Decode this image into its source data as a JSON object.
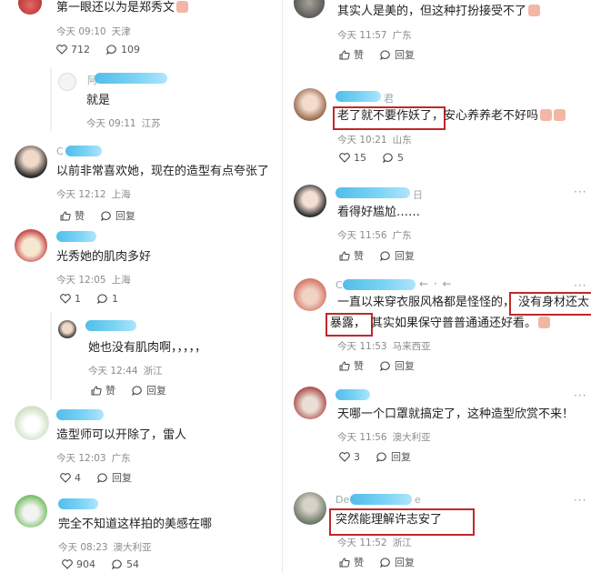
{
  "left": {
    "comments": [
      {
        "text": "第一眼还以为是郑秀文",
        "time": "今天 09:10",
        "loc": "天津",
        "likes": "712",
        "replies": "109"
      },
      {
        "prefix": "阿",
        "text": "就是",
        "time": "今天 09:11",
        "loc": "江苏"
      },
      {
        "prefix": "C",
        "text": "以前非常喜欢她，现在的造型有点夸张了",
        "time": "今天 12:12",
        "loc": "上海",
        "like_label": "赞",
        "reply_label": "回复"
      },
      {
        "text": "光秀她的肌肉多好",
        "time": "今天 12:05",
        "loc": "上海",
        "likes": "1",
        "replies": "1"
      },
      {
        "text": "她也没有肌肉啊，，，，，",
        "time": "今天 12:44",
        "loc": "浙江",
        "like_label": "赞",
        "reply_label": "回复"
      },
      {
        "text": "造型师可以开除了，雷人",
        "time": "今天 12:03",
        "loc": "广东",
        "likes": "4",
        "reply_label": "回复"
      },
      {
        "text": "完全不知道这样拍的美感在哪",
        "time": "今天 08:23",
        "loc": "澳大利亚",
        "likes": "904",
        "replies": "54"
      }
    ]
  },
  "right": {
    "comments": [
      {
        "text": "其实人是美的，但这种打扮接受不了",
        "time": "今天 11:57",
        "loc": "广东",
        "like_label": "赞",
        "reply_label": "回复"
      },
      {
        "suffix": "君",
        "text_boxed": "老了就不要作妖了，",
        "text_rest": "安心养养老不好吗",
        "time": "今天 10:21",
        "loc": "山东",
        "likes": "15",
        "replies": "5"
      },
      {
        "suffix": "日",
        "text": "看得好尴尬……",
        "time": "今天 11:56",
        "loc": "广东",
        "like_label": "赞",
        "reply_label": "回复"
      },
      {
        "prefix": "C",
        "text_line1_a": "一直以来穿衣服风格都是怪怪的，",
        "text_line1_boxed": "没有身材还太",
        "text_line2_boxed": "暴露，",
        "text_line2_rest": "其实如果保守普普通通还好看。",
        "time": "今天 11:53",
        "loc": "马来西亚",
        "like_label": "赞",
        "reply_label": "回复"
      },
      {
        "text": "天哪一个口罩就搞定了，这种造型欣赏不来！",
        "time": "今天 11:56",
        "loc": "澳大利亚",
        "likes": "3",
        "reply_label": "回复"
      },
      {
        "prefix": "De",
        "suffix": "e",
        "text_boxed": "突然能理解许志安了",
        "time": "今天 11:52",
        "loc": "浙江",
        "like_label": "赞",
        "reply_label": "回复"
      }
    ]
  },
  "colors": {
    "highlight": "#c0282a",
    "blur": "#3fb6e8",
    "meta": "#8a8a8a"
  }
}
